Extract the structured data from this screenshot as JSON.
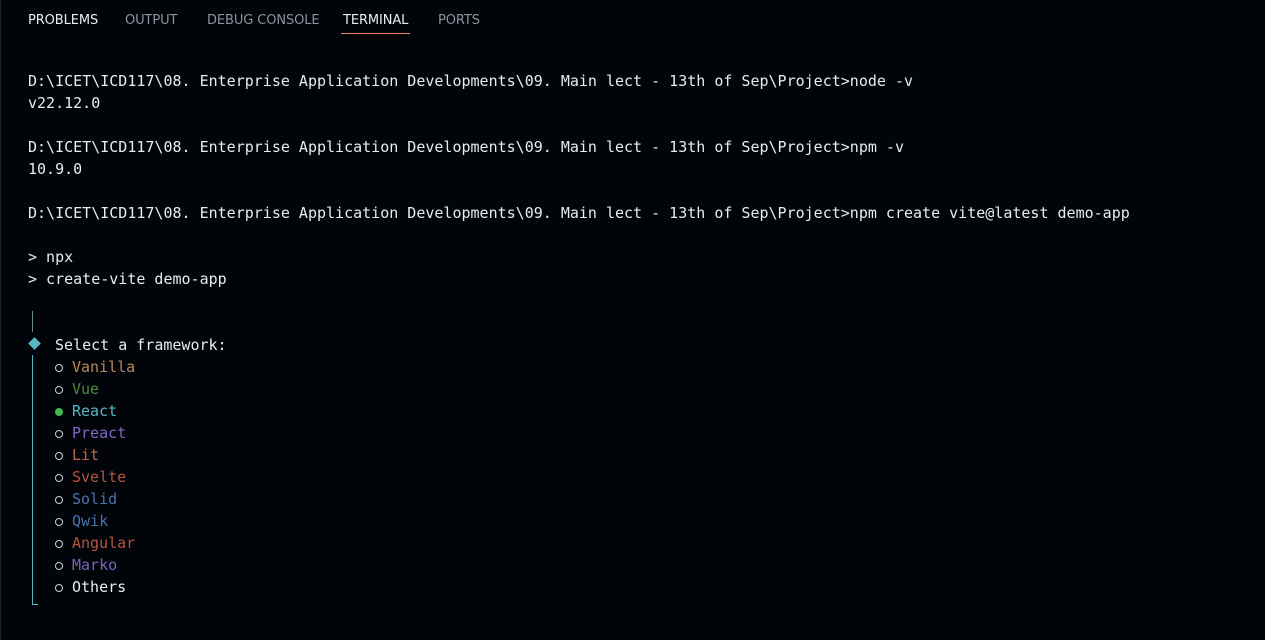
{
  "tabs": [
    {
      "label": "PROBLEMS"
    },
    {
      "label": "OUTPUT"
    },
    {
      "label": "DEBUG CONSOLE"
    },
    {
      "label": "TERMINAL"
    },
    {
      "label": "PORTS"
    }
  ],
  "active_tab": "TERMINAL",
  "terminal": {
    "cmd1": "D:\\ICET\\ICD117\\08. Enterprise Application Developments\\09. Main lect - 13th of Sep\\Project>node -v",
    "out1": "v22.12.0",
    "cmd2": "D:\\ICET\\ICD117\\08. Enterprise Application Developments\\09. Main lect - 13th of Sep\\Project>npm -v",
    "out2": "10.9.0",
    "cmd3": "D:\\ICET\\ICD117\\08. Enterprise Application Developments\\09. Main lect - 13th of Sep\\Project>npm create vite@latest demo-app",
    "npx1": "> npx",
    "npx2": "> create-vite demo-app",
    "prompt": "Select a framework:",
    "options": [
      {
        "label": "Vanilla",
        "color": "#b88a5a",
        "selected": false
      },
      {
        "label": "Vue",
        "color": "#4e8a3e",
        "selected": false
      },
      {
        "label": "React",
        "color": "#56b6c2",
        "selected": true
      },
      {
        "label": "Preact",
        "color": "#8268c4",
        "selected": false
      },
      {
        "label": "Lit",
        "color": "#c0674d",
        "selected": false
      },
      {
        "label": "Svelte",
        "color": "#b5553d",
        "selected": false
      },
      {
        "label": "Solid",
        "color": "#4a74a8",
        "selected": false
      },
      {
        "label": "Qwik",
        "color": "#4a74a8",
        "selected": false
      },
      {
        "label": "Angular",
        "color": "#b5553d",
        "selected": false
      },
      {
        "label": "Marko",
        "color": "#7a64b8",
        "selected": false
      },
      {
        "label": "Others",
        "color": "#e6edf3",
        "selected": false
      }
    ]
  },
  "colors": {
    "background": "#010409",
    "text": "#e6edf3",
    "tab_inactive": "#8b949e",
    "tab_underline": "#f78166",
    "prompt_accent": "#56b6c2",
    "selected_dot": "#3fb950"
  }
}
